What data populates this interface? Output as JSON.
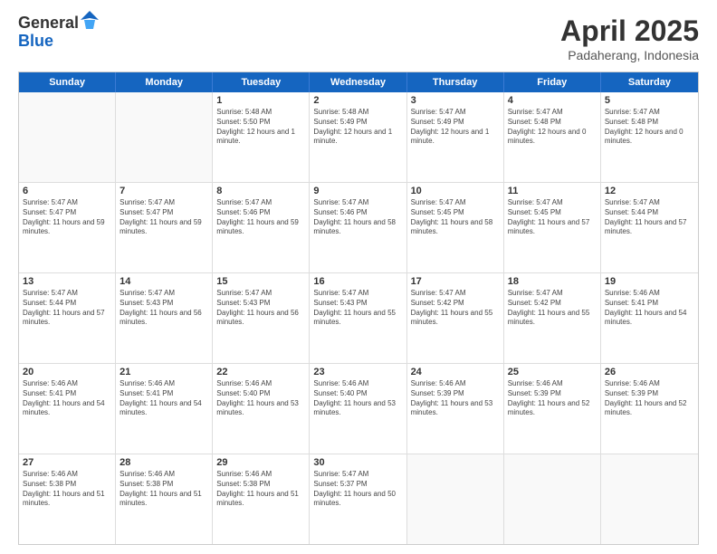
{
  "header": {
    "logo_general": "General",
    "logo_blue": "Blue",
    "title": "April 2025",
    "location": "Padaherang, Indonesia"
  },
  "calendar": {
    "days_of_week": [
      "Sunday",
      "Monday",
      "Tuesday",
      "Wednesday",
      "Thursday",
      "Friday",
      "Saturday"
    ],
    "rows": [
      [
        {
          "day": "",
          "empty": true
        },
        {
          "day": "",
          "empty": true
        },
        {
          "day": "1",
          "sunrise": "Sunrise: 5:48 AM",
          "sunset": "Sunset: 5:50 PM",
          "daylight": "Daylight: 12 hours and 1 minute."
        },
        {
          "day": "2",
          "sunrise": "Sunrise: 5:48 AM",
          "sunset": "Sunset: 5:49 PM",
          "daylight": "Daylight: 12 hours and 1 minute."
        },
        {
          "day": "3",
          "sunrise": "Sunrise: 5:47 AM",
          "sunset": "Sunset: 5:49 PM",
          "daylight": "Daylight: 12 hours and 1 minute."
        },
        {
          "day": "4",
          "sunrise": "Sunrise: 5:47 AM",
          "sunset": "Sunset: 5:48 PM",
          "daylight": "Daylight: 12 hours and 0 minutes."
        },
        {
          "day": "5",
          "sunrise": "Sunrise: 5:47 AM",
          "sunset": "Sunset: 5:48 PM",
          "daylight": "Daylight: 12 hours and 0 minutes."
        }
      ],
      [
        {
          "day": "6",
          "sunrise": "Sunrise: 5:47 AM",
          "sunset": "Sunset: 5:47 PM",
          "daylight": "Daylight: 11 hours and 59 minutes."
        },
        {
          "day": "7",
          "sunrise": "Sunrise: 5:47 AM",
          "sunset": "Sunset: 5:47 PM",
          "daylight": "Daylight: 11 hours and 59 minutes."
        },
        {
          "day": "8",
          "sunrise": "Sunrise: 5:47 AM",
          "sunset": "Sunset: 5:46 PM",
          "daylight": "Daylight: 11 hours and 59 minutes."
        },
        {
          "day": "9",
          "sunrise": "Sunrise: 5:47 AM",
          "sunset": "Sunset: 5:46 PM",
          "daylight": "Daylight: 11 hours and 58 minutes."
        },
        {
          "day": "10",
          "sunrise": "Sunrise: 5:47 AM",
          "sunset": "Sunset: 5:45 PM",
          "daylight": "Daylight: 11 hours and 58 minutes."
        },
        {
          "day": "11",
          "sunrise": "Sunrise: 5:47 AM",
          "sunset": "Sunset: 5:45 PM",
          "daylight": "Daylight: 11 hours and 57 minutes."
        },
        {
          "day": "12",
          "sunrise": "Sunrise: 5:47 AM",
          "sunset": "Sunset: 5:44 PM",
          "daylight": "Daylight: 11 hours and 57 minutes."
        }
      ],
      [
        {
          "day": "13",
          "sunrise": "Sunrise: 5:47 AM",
          "sunset": "Sunset: 5:44 PM",
          "daylight": "Daylight: 11 hours and 57 minutes."
        },
        {
          "day": "14",
          "sunrise": "Sunrise: 5:47 AM",
          "sunset": "Sunset: 5:43 PM",
          "daylight": "Daylight: 11 hours and 56 minutes."
        },
        {
          "day": "15",
          "sunrise": "Sunrise: 5:47 AM",
          "sunset": "Sunset: 5:43 PM",
          "daylight": "Daylight: 11 hours and 56 minutes."
        },
        {
          "day": "16",
          "sunrise": "Sunrise: 5:47 AM",
          "sunset": "Sunset: 5:43 PM",
          "daylight": "Daylight: 11 hours and 55 minutes."
        },
        {
          "day": "17",
          "sunrise": "Sunrise: 5:47 AM",
          "sunset": "Sunset: 5:42 PM",
          "daylight": "Daylight: 11 hours and 55 minutes."
        },
        {
          "day": "18",
          "sunrise": "Sunrise: 5:47 AM",
          "sunset": "Sunset: 5:42 PM",
          "daylight": "Daylight: 11 hours and 55 minutes."
        },
        {
          "day": "19",
          "sunrise": "Sunrise: 5:46 AM",
          "sunset": "Sunset: 5:41 PM",
          "daylight": "Daylight: 11 hours and 54 minutes."
        }
      ],
      [
        {
          "day": "20",
          "sunrise": "Sunrise: 5:46 AM",
          "sunset": "Sunset: 5:41 PM",
          "daylight": "Daylight: 11 hours and 54 minutes."
        },
        {
          "day": "21",
          "sunrise": "Sunrise: 5:46 AM",
          "sunset": "Sunset: 5:41 PM",
          "daylight": "Daylight: 11 hours and 54 minutes."
        },
        {
          "day": "22",
          "sunrise": "Sunrise: 5:46 AM",
          "sunset": "Sunset: 5:40 PM",
          "daylight": "Daylight: 11 hours and 53 minutes."
        },
        {
          "day": "23",
          "sunrise": "Sunrise: 5:46 AM",
          "sunset": "Sunset: 5:40 PM",
          "daylight": "Daylight: 11 hours and 53 minutes."
        },
        {
          "day": "24",
          "sunrise": "Sunrise: 5:46 AM",
          "sunset": "Sunset: 5:39 PM",
          "daylight": "Daylight: 11 hours and 53 minutes."
        },
        {
          "day": "25",
          "sunrise": "Sunrise: 5:46 AM",
          "sunset": "Sunset: 5:39 PM",
          "daylight": "Daylight: 11 hours and 52 minutes."
        },
        {
          "day": "26",
          "sunrise": "Sunrise: 5:46 AM",
          "sunset": "Sunset: 5:39 PM",
          "daylight": "Daylight: 11 hours and 52 minutes."
        }
      ],
      [
        {
          "day": "27",
          "sunrise": "Sunrise: 5:46 AM",
          "sunset": "Sunset: 5:38 PM",
          "daylight": "Daylight: 11 hours and 51 minutes."
        },
        {
          "day": "28",
          "sunrise": "Sunrise: 5:46 AM",
          "sunset": "Sunset: 5:38 PM",
          "daylight": "Daylight: 11 hours and 51 minutes."
        },
        {
          "day": "29",
          "sunrise": "Sunrise: 5:46 AM",
          "sunset": "Sunset: 5:38 PM",
          "daylight": "Daylight: 11 hours and 51 minutes."
        },
        {
          "day": "30",
          "sunrise": "Sunrise: 5:47 AM",
          "sunset": "Sunset: 5:37 PM",
          "daylight": "Daylight: 11 hours and 50 minutes."
        },
        {
          "day": "",
          "empty": true
        },
        {
          "day": "",
          "empty": true
        },
        {
          "day": "",
          "empty": true
        }
      ]
    ]
  }
}
